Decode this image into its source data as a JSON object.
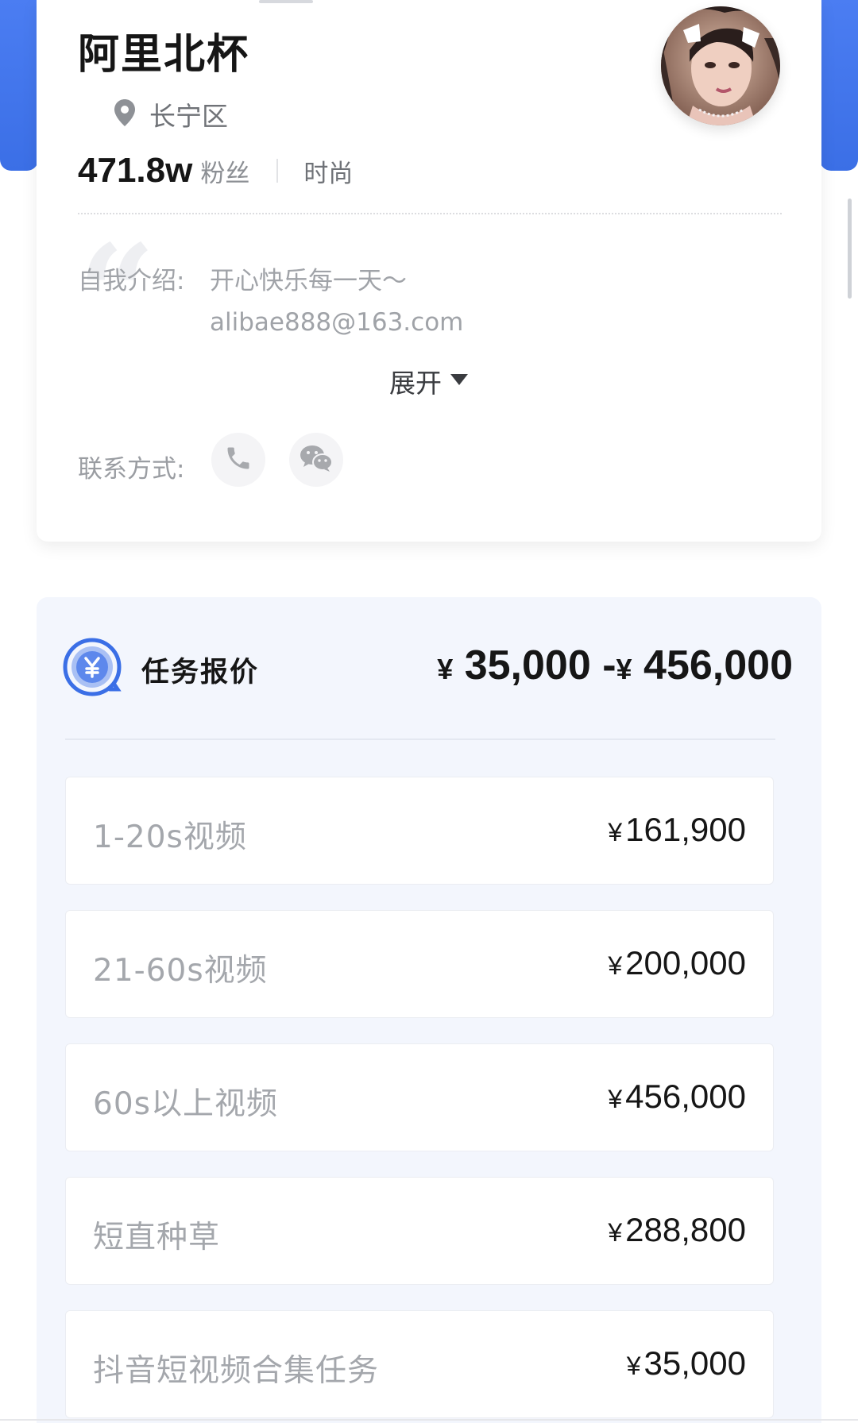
{
  "profile": {
    "name": "阿里北杯",
    "location": "长宁区",
    "fans_count": "471.8w",
    "fans_label": "粉丝",
    "category": "时尚",
    "intro_label": "自我介绍:",
    "intro_text": "开心快乐每一天～",
    "intro_email": "alibae888@163.com",
    "expand_label": "展开",
    "contact_label": "联系方式:",
    "icons": [
      "location-pin-icon",
      "chevron-down-icon",
      "phone-icon",
      "wechat-icon",
      "yen-coin-icon"
    ]
  },
  "quote": {
    "title": "任务报价",
    "range_min_currency": "¥",
    "range_min": "35,000",
    "range_sep": "-",
    "range_max_currency": "¥",
    "range_max": "456,000",
    "items": [
      {
        "label": "1-20s视频",
        "currency": "¥",
        "price": "161,900"
      },
      {
        "label": "21-60s视频",
        "currency": "¥",
        "price": "200,000"
      },
      {
        "label": "60s以上视频",
        "currency": "¥",
        "price": "456,000"
      },
      {
        "label": "短直种草",
        "currency": "¥",
        "price": "288,800"
      },
      {
        "label": "抖音短视频合集任务",
        "currency": "¥",
        "price": "35,000"
      }
    ]
  },
  "colors": {
    "accent_blue": "#3b6fe6",
    "panel_bg": "#f3f6fd",
    "text_primary": "#161616",
    "text_muted": "#a4a7ac"
  }
}
